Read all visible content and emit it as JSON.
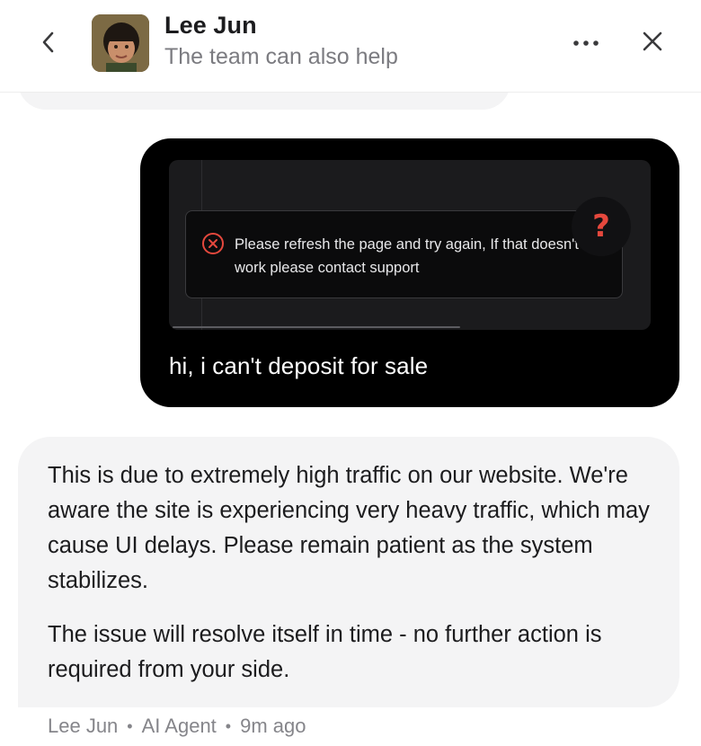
{
  "header": {
    "name": "Lee Jun",
    "subtitle": "The team can also help",
    "icons": {
      "back": "chevron-left-icon",
      "more": "more-horizontal-icon",
      "close": "close-icon"
    }
  },
  "messages": {
    "user": {
      "attachment": {
        "error_text": "Please refresh the page and try again, If that doesn't work please contact support",
        "help_glyph": "?",
        "error_color": "#e5483d"
      },
      "text": "hi, i can't deposit for sale"
    },
    "agent": {
      "paragraphs": [
        "This is due to extremely high traffic on our website. We're aware the site is experiencing very heavy traffic, which may cause UI delays. Please remain patient as the system stabilizes.",
        "The issue will resolve itself in time - no further action is required from your side."
      ],
      "meta": {
        "author": "Lee Jun",
        "role": "AI Agent",
        "time": "9m ago",
        "separator": "•"
      }
    }
  }
}
